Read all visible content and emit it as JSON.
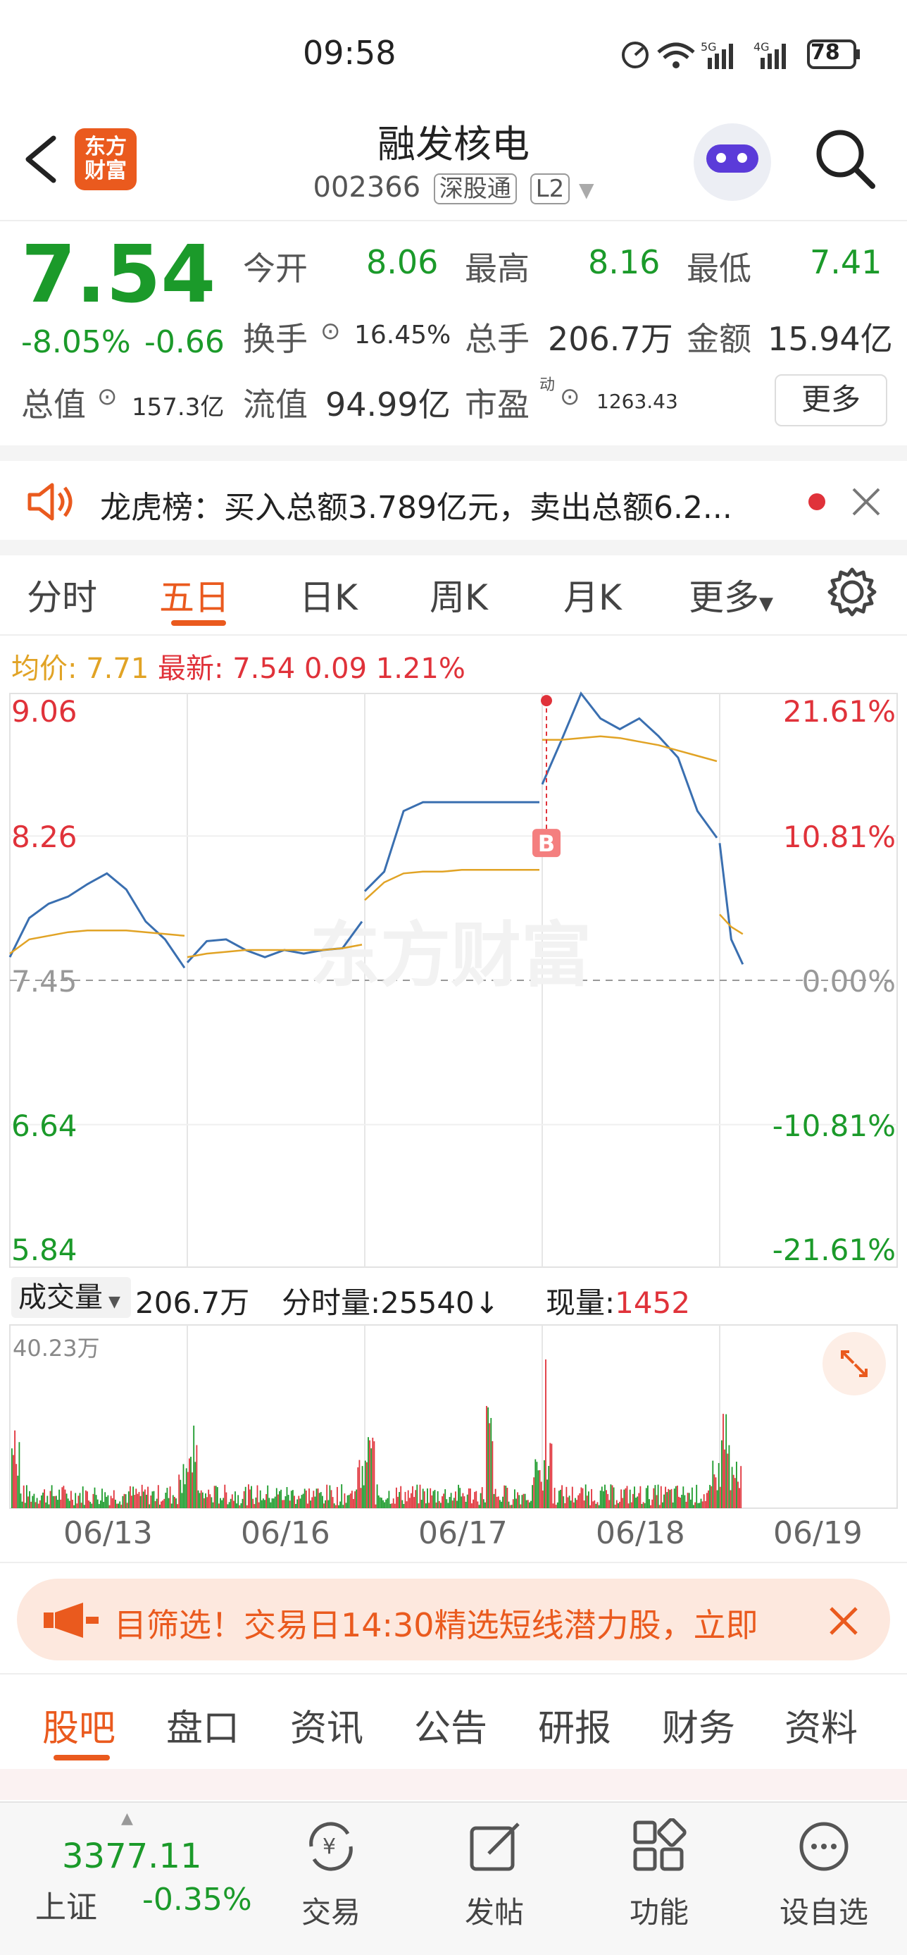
{
  "status_bar": {
    "time": "09:58",
    "battery": "78"
  },
  "header": {
    "logo_text": "东方\n财富",
    "name": "融发核电",
    "code": "002366",
    "tag1": "深股通",
    "tag2": "L2"
  },
  "quote": {
    "price": "7.54",
    "change_pct": "-8.05%",
    "change": "-0.66",
    "open_label": "今开",
    "open": "8.06",
    "high_label": "最高",
    "high": "8.16",
    "low_label": "最低",
    "low": "7.41",
    "turnover_label": "换手",
    "turnover": "16.45%",
    "volume_label": "总手",
    "volume": "206.7万",
    "amount_label": "金额",
    "amount": "15.94亿",
    "mktcap_label": "总值",
    "mktcap": "157.3亿",
    "float_label": "流值",
    "float": "94.99亿",
    "pe_label": "市盈",
    "pe_sup": "动",
    "pe": "1263.43",
    "more_button": "更多"
  },
  "notice": {
    "text": "龙虎榜：买入总额3.789亿元，卖出总额6.2..."
  },
  "chart_tabs": {
    "items": [
      "分时",
      "五日",
      "日K",
      "周K",
      "月K",
      "更多"
    ],
    "active": 1
  },
  "chart_info": {
    "avg_label": "均价:",
    "avg": "7.71",
    "latest_label": "最新:",
    "latest": "7.54",
    "latest_chg": "0.09",
    "latest_pct": "1.21%"
  },
  "chart_data": {
    "type": "line",
    "y_left_ticks": [
      "9.06",
      "8.26",
      "7.45",
      "6.64",
      "5.84"
    ],
    "y_right_ticks": [
      "21.61%",
      "10.81%",
      "0.00%",
      "-10.81%",
      "-21.61%"
    ],
    "x_days": [
      "06/13",
      "06/16",
      "06/17",
      "06/18",
      "06/19"
    ],
    "ylim": [
      5.84,
      9.06
    ],
    "watermark": "东方财富",
    "series": [
      {
        "name": "price",
        "color": "#3a6fb0",
        "days": [
          [
            7.58,
            7.8,
            7.88,
            7.92,
            7.99,
            8.05,
            7.96,
            7.78,
            7.68,
            7.52
          ],
          [
            7.55,
            7.67,
            7.68,
            7.62,
            7.58,
            7.62,
            7.6,
            7.62,
            7.63,
            7.78
          ],
          [
            7.95,
            8.06,
            8.4,
            8.45,
            8.45,
            8.45,
            8.45,
            8.45,
            8.45,
            8.45
          ],
          [
            8.55,
            8.8,
            9.06,
            8.92,
            8.86,
            8.92,
            8.82,
            8.7,
            8.4,
            8.25
          ],
          [
            8.22,
            7.68,
            7.54
          ]
        ]
      },
      {
        "name": "average",
        "color": "#e1a325",
        "days": [
          [
            7.6,
            7.68,
            7.7,
            7.72,
            7.73,
            7.73,
            7.73,
            7.72,
            7.71,
            7.7
          ],
          [
            7.58,
            7.6,
            7.61,
            7.62,
            7.62,
            7.62,
            7.62,
            7.62,
            7.63,
            7.65
          ],
          [
            7.9,
            8.0,
            8.05,
            8.06,
            8.06,
            8.07,
            8.07,
            8.07,
            8.07,
            8.07
          ],
          [
            8.8,
            8.8,
            8.81,
            8.82,
            8.81,
            8.79,
            8.77,
            8.74,
            8.71,
            8.68
          ],
          [
            7.82,
            7.75,
            7.71
          ]
        ]
      }
    ],
    "marker": {
      "label": "B",
      "day": 3,
      "price": 9.02
    }
  },
  "volume_bar": {
    "dropdown": "成交量",
    "total": "206.7万",
    "tick_label": "分时量:25540",
    "arrow": "↓",
    "now_label": "现量:",
    "now": "1452",
    "max_label": "40.23万"
  },
  "ad_banner": {
    "text": "目筛选！交易日14:30精选短线潜力股，立即"
  },
  "bottom_tabs": {
    "items": [
      "股吧",
      "盘口",
      "资讯",
      "公告",
      "研报",
      "财务",
      "资料"
    ],
    "active": 0
  },
  "bottom_nav": {
    "index_value": "3377.11",
    "index_name": "上证",
    "index_change": "-0.35%",
    "trade": "交易",
    "post": "发帖",
    "functions": "功能",
    "watchlist": "设自选"
  },
  "colors": {
    "up": "#e0323a",
    "down": "#1b9a2a",
    "accent": "#ea5a1e",
    "price_line": "#3a6fb0",
    "avg_line": "#e1a325"
  }
}
